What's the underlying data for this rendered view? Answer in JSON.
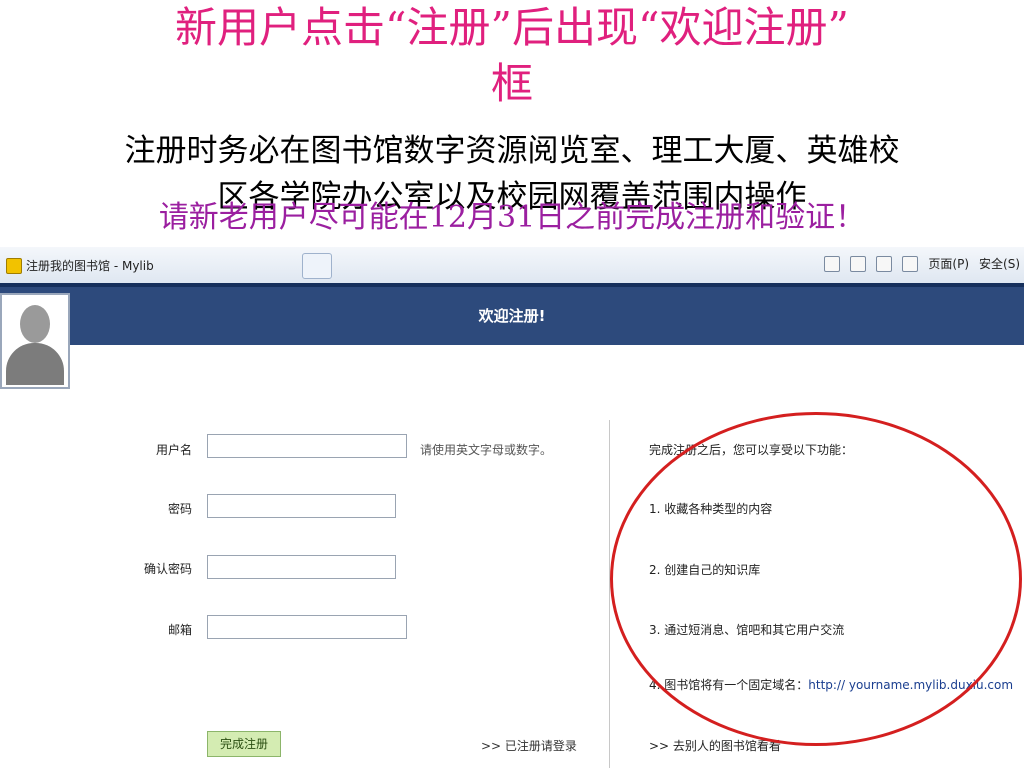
{
  "slide": {
    "title_line1": "新用户点击“注册”后出现“欢迎注册”",
    "title_line2": "框",
    "note_line1": "注册时务必在图书馆数字资源阅览室、理工大厦、英雄校",
    "note_line2": "区各学院办公室以及校园网覆盖范围内操作",
    "warning": "请新老用户尽可能在12月31日之前完成注册和验证！"
  },
  "browser": {
    "tab_title": "注册我的图书馆 - Mylib",
    "toolbar": {
      "page_label": "页面(P)",
      "security_label": "安全(S)"
    }
  },
  "page": {
    "welcome": "欢迎注册!",
    "form": {
      "username_label": "用户名",
      "username_hint": "请使用英文字母或数字。",
      "password_label": "密码",
      "confirm_label": "确认密码",
      "email_label": "邮箱",
      "submit_label": "完成注册",
      "login_link": ">> 已注册请登录"
    },
    "benefits": {
      "intro": "完成注册之后，您可以享受以下功能：",
      "item1": "1. 收藏各种类型的内容",
      "item2": "2. 创建自己的知识库",
      "item3": "3. 通过短消息、馆吧和其它用户交流",
      "item4_text": "4. 图书馆将有一个固定域名：",
      "item4_url": "http:// yourname.mylib.duxiu.com",
      "visit_link": ">> 去别人的图书馆看看"
    }
  },
  "colors": {
    "title": "#e0207e",
    "warning": "#9b1fa0",
    "header": "#2d4a7c",
    "highlight_circle": "#d41f1f"
  }
}
